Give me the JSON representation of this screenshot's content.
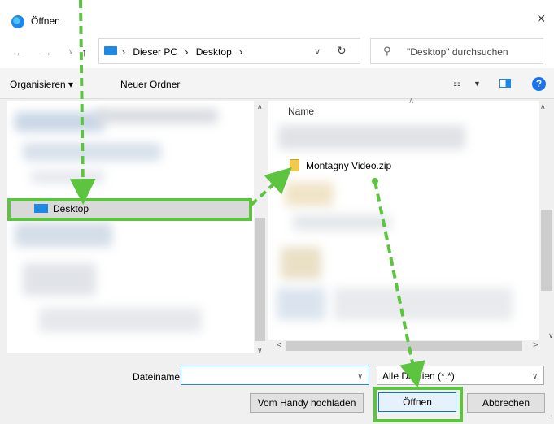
{
  "window": {
    "title": "Öffnen",
    "close_symbol": "×"
  },
  "nav": {
    "back_symbol": "←",
    "forward_symbol": "→",
    "recent_symbol": "∨",
    "up_symbol": "↑",
    "breadcrumbs": [
      "Dieser PC",
      "Desktop"
    ],
    "breadcrumb_sep": "›",
    "path_dropdown_symbol": "∨",
    "refresh_symbol": "↻",
    "search_placeholder": "\"Desktop\" durchsuchen",
    "search_symbol": "⚲"
  },
  "toolbar": {
    "organize_label": "Organisieren ▾",
    "new_folder_label": "Neuer Ordner",
    "view_symbol": "☷",
    "view_dropdown_symbol": "▼",
    "help_symbol": "?"
  },
  "left_pane": {
    "selected_item": "Desktop",
    "scroll_up_symbol": "∧",
    "scroll_down_symbol": "∨"
  },
  "right_pane": {
    "column_header": "Name",
    "sort_symbol": "∧",
    "file": "Montagny Video.zip",
    "scroll_left_symbol": "<",
    "scroll_right_symbol": ">",
    "scroll_up_symbol": "∧",
    "scroll_down_symbol": "∨"
  },
  "bottom": {
    "filename_label": "Dateiname:",
    "filename_value": "",
    "filename_dropdown_symbol": "∨",
    "filetype_value": "Alle Dateien (*.*)",
    "filetype_dropdown_symbol": "∨",
    "upload_button": "Vom Handy hochladen",
    "open_button": "Öffnen",
    "cancel_button": "Abbrechen",
    "grip_symbol": "⋰"
  },
  "colors": {
    "annotation_green": "#5cc43f",
    "accent_blue": "#1e88e5",
    "selection_gray": "#d9d9d9"
  }
}
